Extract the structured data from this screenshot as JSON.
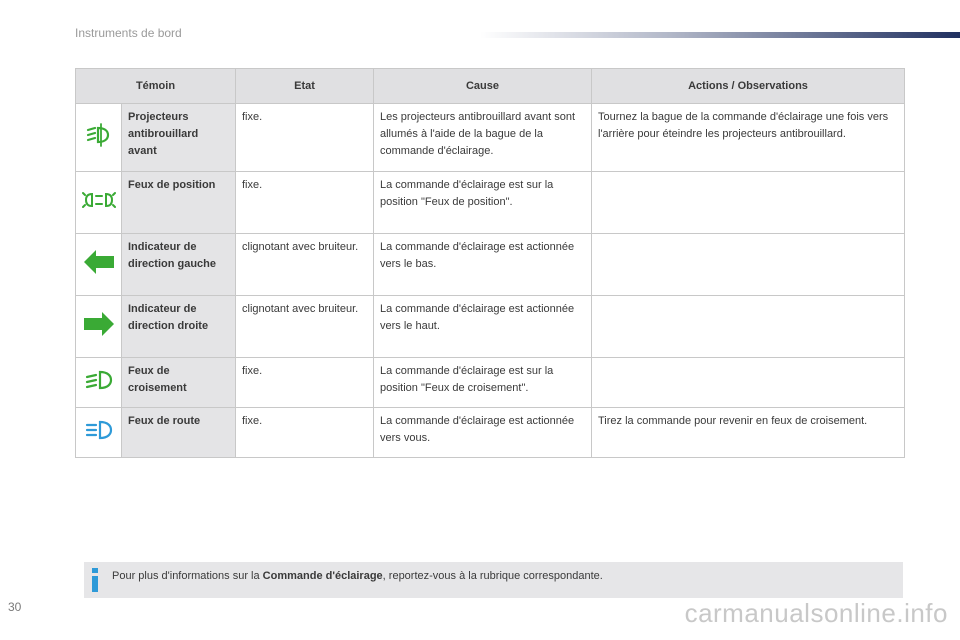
{
  "header": {
    "title": "Instruments de bord"
  },
  "table": {
    "columns": [
      "Témoin",
      "Etat",
      "Cause",
      "Actions / Observations"
    ],
    "rows": [
      {
        "icon": "front-fog-lamp-icon",
        "name": "Projecteurs antibrouillard avant",
        "state": "fixe.",
        "cause": "Les projecteurs antibrouillard avant sont allumés à l'aide de la bague de la commande d'éclairage.",
        "action": "Tournez la bague de la commande d'éclairage une fois vers l'arrière pour éteindre les projecteurs antibrouillard."
      },
      {
        "icon": "position-lamp-icon",
        "name": "Feux de position",
        "state": "fixe.",
        "cause": "La commande d'éclairage est sur la position \"Feux de position\".",
        "action": ""
      },
      {
        "icon": "left-arrow-icon",
        "name": "Indicateur de direction gauche",
        "state": "clignotant avec bruiteur.",
        "cause": "La commande d'éclairage est actionnée vers le bas.",
        "action": ""
      },
      {
        "icon": "right-arrow-icon",
        "name": "Indicateur de direction droite",
        "state": "clignotant avec bruiteur.",
        "cause": "La commande d'éclairage est actionnée vers le haut.",
        "action": ""
      },
      {
        "icon": "dipped-beam-icon",
        "name": "Feux de croisement",
        "state": "fixe.",
        "cause": "La commande d'éclairage est sur la position \"Feux de croisement\".",
        "action": ""
      },
      {
        "icon": "main-beam-icon",
        "name": "Feux de route",
        "state": "fixe.",
        "cause": "La commande d'éclairage est actionnée vers vous.",
        "action": "Tirez la commande pour revenir en feux de croisement."
      }
    ]
  },
  "info": {
    "prefix": "Pour plus d'informations sur la ",
    "bold": "Commande d'éclairage",
    "suffix": ", reportez-vous à la rubrique correspondante."
  },
  "footer": {
    "page_number": "30",
    "watermark": "carmanualsonline.info"
  },
  "colors": {
    "green": "#3aaa35",
    "info_blue": "#2e9ad8",
    "header_bar": "#203060"
  }
}
